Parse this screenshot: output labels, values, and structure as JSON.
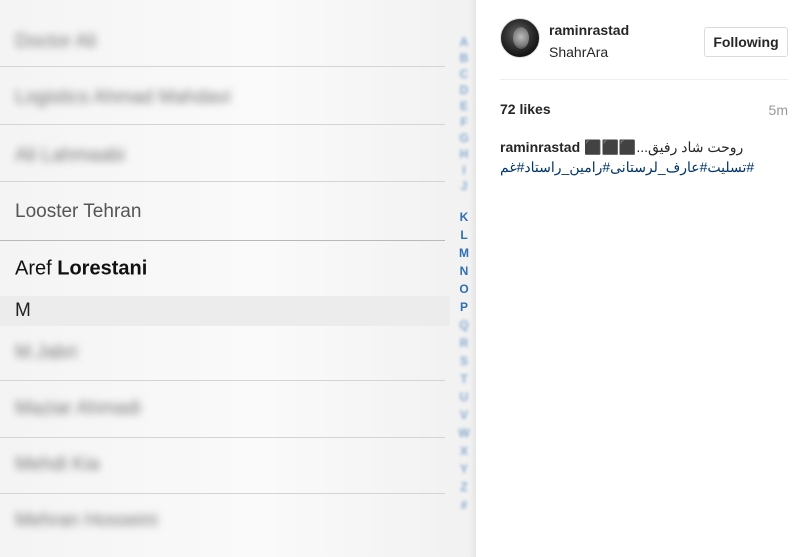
{
  "photo": {
    "contacts_above": [
      "Doctor Ali",
      "Logistics Ahmad Mahdavi",
      "Ali Lahmaabi"
    ],
    "looster": "Looster Tehran",
    "aref_first": "Aref",
    "aref_last": "Lorestani",
    "section_letter": "M",
    "contacts_below": [
      "M.Jabri",
      "Maziar Ahmadi",
      "Mehdi Kia",
      "Mehran Hosseini"
    ],
    "index_letters": [
      "A",
      "B",
      "C",
      "D",
      "E",
      "F",
      "G",
      "H",
      "I",
      "J",
      "K",
      "L",
      "M",
      "N",
      "O",
      "P",
      "Q",
      "R",
      "S",
      "T",
      "U",
      "V",
      "W",
      "X",
      "Y",
      "Z",
      "#"
    ]
  },
  "post": {
    "username": "raminrastad",
    "location": "ShahrAra",
    "follow_label": "Following",
    "likes": "72 likes",
    "time": "5m",
    "caption_user": "raminrastad",
    "caption_text": "روحت شاد رفیق...⬛⬛⬛",
    "hashtags": "#تسلیت#عارف_لرستانی#رامین_راستاد#غم"
  }
}
